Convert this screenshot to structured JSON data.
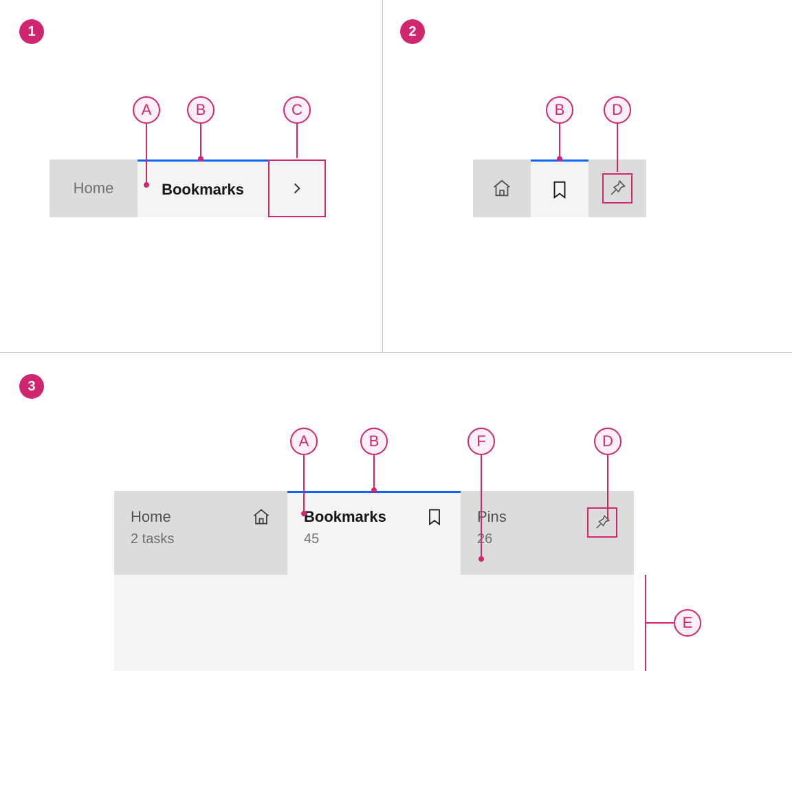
{
  "panels": {
    "one": {
      "badge": "1"
    },
    "two": {
      "badge": "2"
    },
    "three": {
      "badge": "3"
    }
  },
  "callouts": {
    "A": "A",
    "B": "B",
    "C": "C",
    "D": "D",
    "E": "E",
    "F": "F"
  },
  "tabs1": {
    "home": "Home",
    "bookmarks": "Bookmarks"
  },
  "tabs3": {
    "home": {
      "title": "Home",
      "sub": "2 tasks"
    },
    "bookmarks": {
      "title": "Bookmarks",
      "sub": "45"
    },
    "pins": {
      "title": "Pins",
      "sub": "26"
    }
  },
  "colors": {
    "accent": "#d02670",
    "selected": "#0f62fe"
  }
}
